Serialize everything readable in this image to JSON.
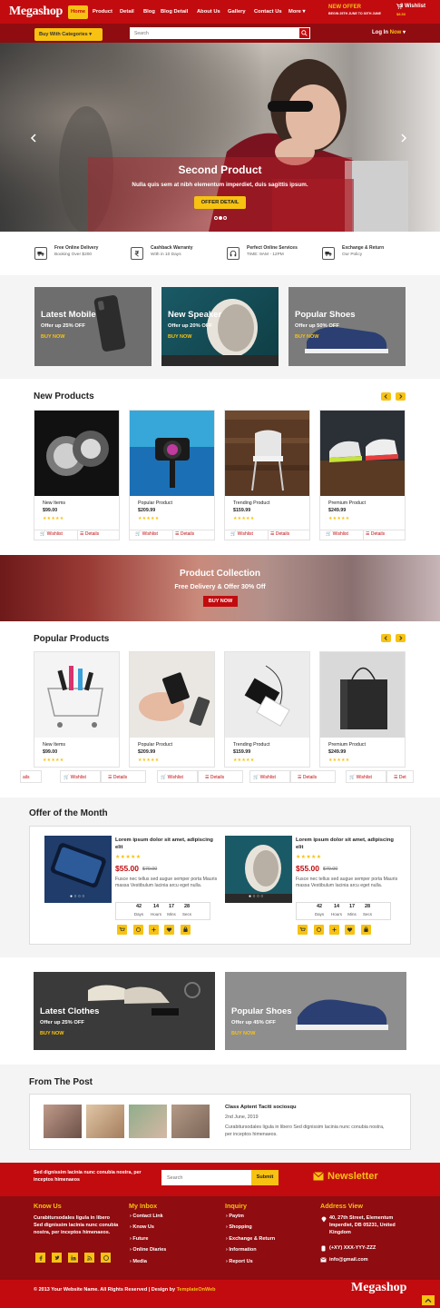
{
  "brand": "Megashop",
  "nav": [
    "Home",
    "Product",
    "Detail",
    "Blog",
    "Blog Detail",
    "About Us",
    "Gallery",
    "Contact Us",
    "More"
  ],
  "promo": {
    "title": "NEW OFFER",
    "dates": "BEGIN 25TH JUNE TO 30TH JUNE"
  },
  "wishlist": {
    "label": "3 Wishlist",
    "price": "$8.50"
  },
  "categories_button": "Buy With Categories",
  "search_placeholder": "Search",
  "login": {
    "text": "Log In",
    "accent": "Now"
  },
  "hero": {
    "title": "Second Product",
    "text": "Nulla quis sem at nibh elementum imperdiet, duis sagittis ipsum.",
    "button": "OFFER DETAIL",
    "slides": 3,
    "active_slide": 1
  },
  "features": [
    {
      "title": "Free Online Delivery",
      "sub": "Booking Over $200",
      "icon": "truck-icon"
    },
    {
      "title": "Cashback Warranty",
      "sub": "With in 10 Days",
      "icon": "rupee-icon"
    },
    {
      "title": "Perfect Online Services",
      "sub": "TIME: 9AM - 12PM",
      "icon": "headphones-icon"
    },
    {
      "title": "Exchange & Return",
      "sub": "Our Policy",
      "icon": "truck-icon"
    }
  ],
  "banners": [
    {
      "title": "Latest Mobile",
      "sub": "Offer up 25% OFF",
      "cta": "BUY NOW"
    },
    {
      "title": "New Speaker",
      "sub": "Offer up 20% OFF",
      "cta": "BUY NOW"
    },
    {
      "title": "Popular Shoes",
      "sub": "Offer up 50% OFF",
      "cta": "BUY NOW"
    }
  ],
  "new_products": {
    "title": "New Products",
    "items": [
      {
        "name": "New Items",
        "price": "$99.00"
      },
      {
        "name": "Popular Product",
        "price": "$209.99"
      },
      {
        "name": "Trending Product",
        "price": "$159.99"
      },
      {
        "name": "Premium Product",
        "price": "$249.99"
      }
    ]
  },
  "stars": "★★★★★",
  "wishlist_label": "Wishlist",
  "details_label": "Details",
  "collection": {
    "title": "Product Collection",
    "sub": "Free Delivery & Offer 30% Off",
    "button": "BUY NOW"
  },
  "popular_products": {
    "title": "Popular Products",
    "items": [
      {
        "name": "New Items",
        "price": "$99.00"
      },
      {
        "name": "Popular Product",
        "price": "$209.99"
      },
      {
        "name": "Trending Product",
        "price": "$159.99"
      },
      {
        "name": "Premium Product",
        "price": "$249.99"
      }
    ],
    "foot": [
      "ails",
      "Wishlist",
      "Details",
      "Wishlist",
      "Details",
      "Wishlist",
      "Det"
    ]
  },
  "offer_month": {
    "title": "Offer of the Month",
    "items": [
      {
        "title": "Lorem ipsum dolor sit amet, adipiscing elit",
        "price": "$55.00",
        "old": "$70.00",
        "desc": "Fusce nec tellus sed augue semper porta Mauris massa Vestibulum lacinia arcu eget nulla.",
        "countdown": [
          {
            "n": "42",
            "l": "Days"
          },
          {
            "n": "14",
            "l": "Hours"
          },
          {
            "n": "17",
            "l": "Mins"
          },
          {
            "n": "28",
            "l": "Secs"
          }
        ]
      },
      {
        "title": "Lorem ipsum dolor sit amet, adipiscing elit",
        "price": "$55.00",
        "old": "$70.00",
        "desc": "Fusce nec tellus sed augue semper porta Mauris massa Vestibulum lacinia arcu eget nulla.",
        "countdown": [
          {
            "n": "42",
            "l": "Days"
          },
          {
            "n": "14",
            "l": "Hours"
          },
          {
            "n": "17",
            "l": "Mins"
          },
          {
            "n": "28",
            "l": "Secs"
          }
        ]
      }
    ]
  },
  "banners2": [
    {
      "title": "Latest Clothes",
      "sub": "Offer up 25% OFF",
      "cta": "BUY NOW"
    },
    {
      "title": "Popular Shoes",
      "sub": "Offer up 45% OFF",
      "cta": "BUY NOW"
    }
  ],
  "post": {
    "section": "From The Post",
    "title": "Class Aptent Taciti sociosqu",
    "date": "2nd June, 2019",
    "text": "Curabitursodales ligula in libero Sed dignissim lacinia nunc conubia nostra, per inceptos himenaeos."
  },
  "newsletter": {
    "text": "Sed dignissim lacinia nunc conubia nostra, per inceptos himenaeos",
    "placeholder": "Search",
    "button": "Submit",
    "title": "Newsletter"
  },
  "footer": {
    "know_us": {
      "title": "Know Us",
      "text": "Curabitursodales ligula in libero Sed dignissim lacinia nunc conubia nostra, per inceptos himenaeos."
    },
    "inbox": {
      "title": "My Inbox",
      "links": [
        "Contact Link",
        "Know Us",
        "Future",
        "Online Diaries",
        "Media"
      ]
    },
    "inquiry": {
      "title": "Inquiry",
      "links": [
        "Paytm",
        "Shopping",
        "Exchange & Return",
        "Information",
        "Report Us"
      ]
    },
    "address": {
      "title": "Address View",
      "addr": "40, 27th Street, Elementum Imperdiet, DB 05231, United Kingdom",
      "phone": "(+XY) XXX-YYY-ZZZ",
      "email": "info@gmail.com"
    },
    "copyright": "© 2013 Your Website Name. All Rights Reserved | Design by ",
    "designer": "TemplateOnWeb"
  },
  "colors": {
    "red": "#c20b0f",
    "dark_red": "#8f0c10",
    "yellow": "#f7c211"
  }
}
